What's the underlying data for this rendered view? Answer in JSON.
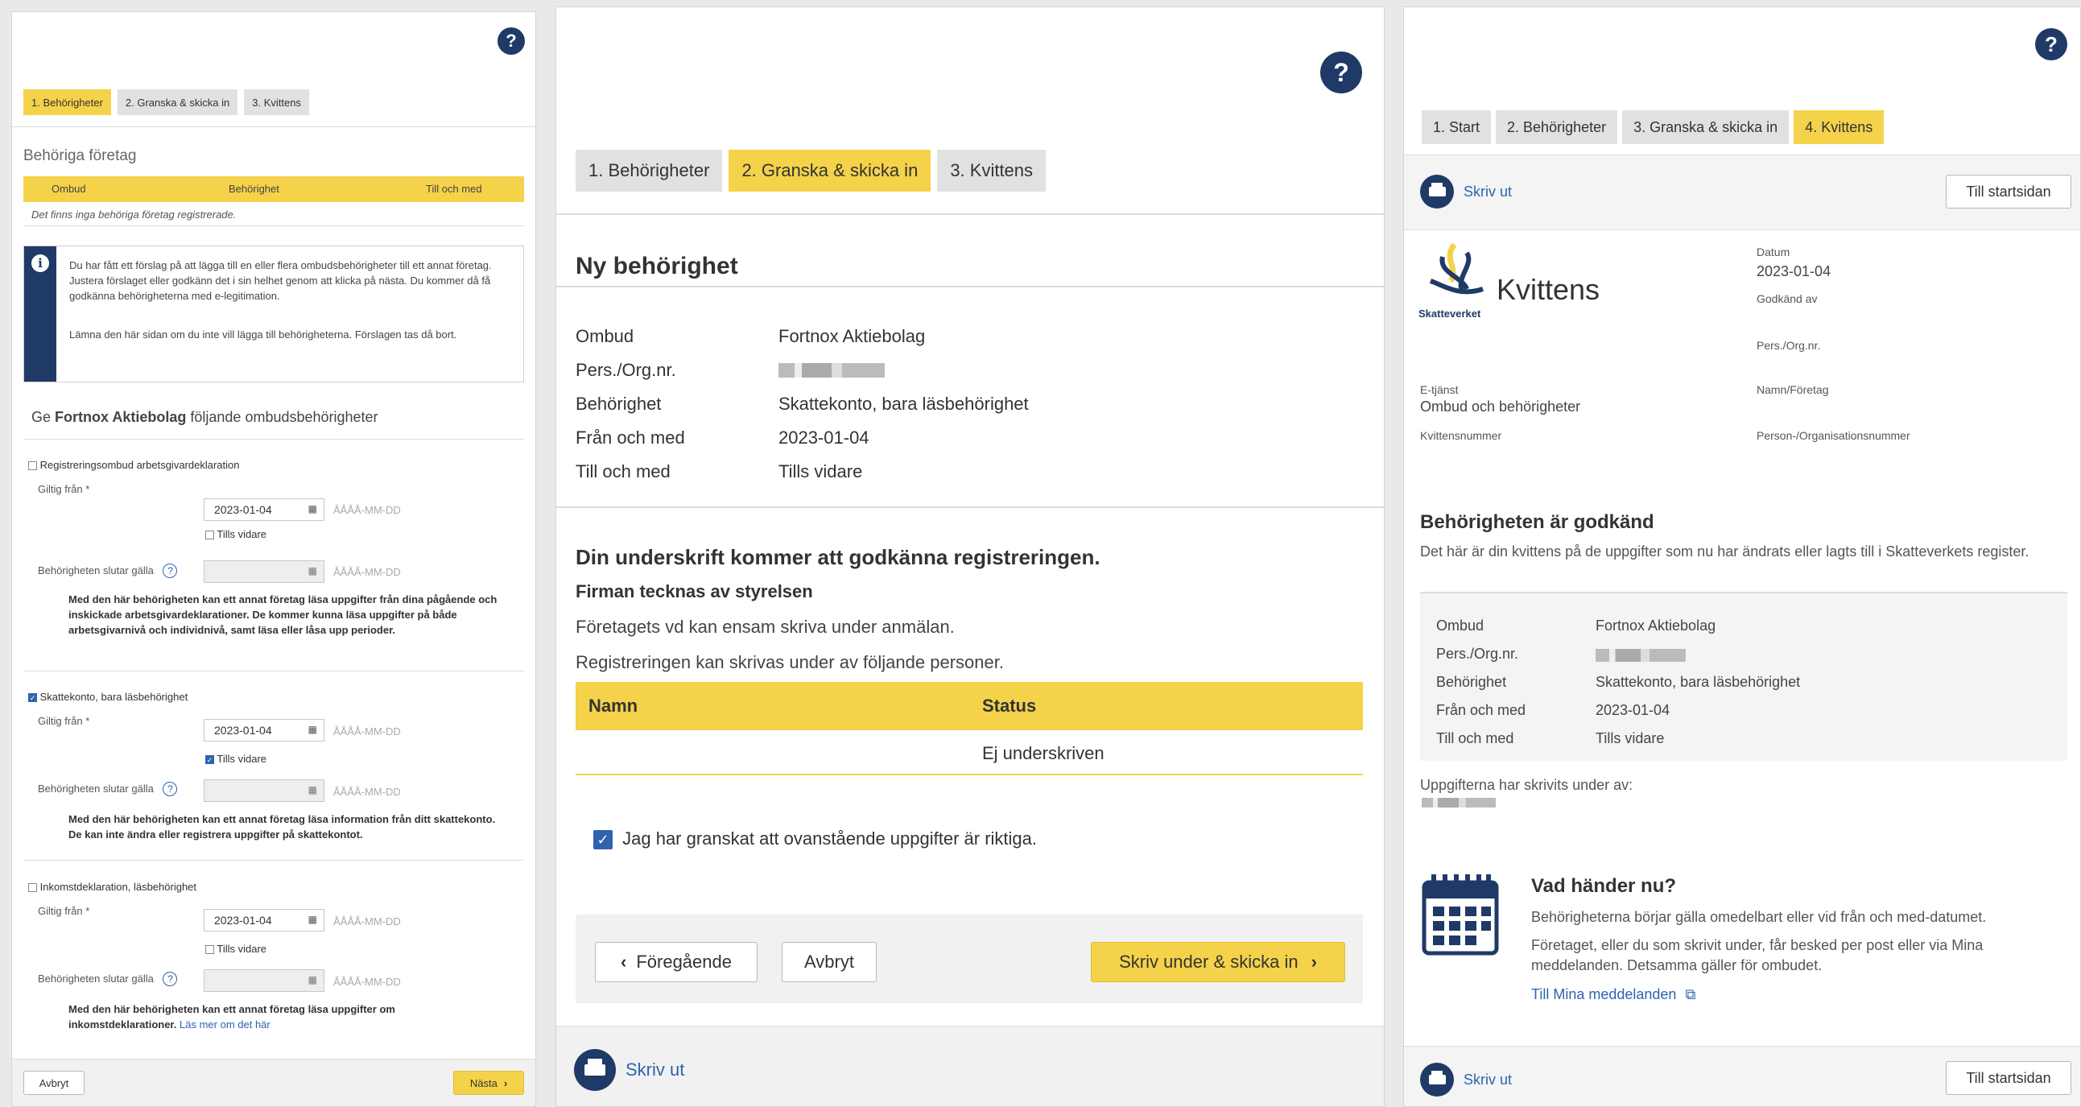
{
  "p1": {
    "help": "?",
    "steps": [
      "1. Behörigheter",
      "2. Granska & skicka in",
      "3. Kvittens"
    ],
    "section_title": "Behöriga företag",
    "table_headers": [
      "Ombud",
      "Behörighet",
      "Till och med"
    ],
    "table_empty": "Det finns inga behöriga företag registrerade.",
    "info_icon": "info-icon",
    "info_text1": "Du har fått ett förslag på att lägga till en eller flera ombudsbehörigheter till ett annat företag. Justera förslaget eller godkänn det i sin helhet genom att klicka på nästa. Du kommer då få godkänna behörigheterna med e-legitimation.",
    "info_text2": "Lämna den här sidan om du inte vill lägga till behörigheterna. Förslagen tas då bort.",
    "ge_prefix": "Ge",
    "ge_company": "Fortnox Aktiebolag",
    "ge_suffix": "följande ombudsbehörigheter",
    "date_placeholder": "ÅÅÅÅ-MM-DD",
    "label_from": "Giltig från *",
    "label_until_vidare": "Tills vidare",
    "label_ends": "Behörigheten slutar gälla",
    "groups": [
      {
        "title": "Registreringsombud arbetsgivardeklaration",
        "checked": false,
        "date": "2023-01-04",
        "tills_checked": false,
        "desc": "Med den här behörigheten kan ett annat företag läsa uppgifter från dina pågående och inskickade arbetsgivardeklarationer. De kommer kunna läsa uppgifter på både arbetsgivarnivå och individnivå, samt läsa eller låsa upp perioder."
      },
      {
        "title": "Skattekonto, bara läsbehörighet",
        "checked": true,
        "date": "2023-01-04",
        "tills_checked": true,
        "desc": "Med den här behörigheten kan ett annat företag läsa information från ditt skattekonto. De kan inte ändra eller registrera uppgifter på skattekontot."
      },
      {
        "title": "Inkomstdeklaration, läsbehörighet",
        "checked": false,
        "date": "2023-01-04",
        "tills_checked": false,
        "desc": "Med den här behörigheten kan ett annat företag läsa uppgifter om inkomstdeklarationer.",
        "link": "Läs mer om det här"
      }
    ],
    "cancel": "Avbryt",
    "next": "Nästa"
  },
  "p2": {
    "help": "?",
    "steps": [
      "1. Behörigheter",
      "2. Granska & skicka in",
      "3. Kvittens"
    ],
    "title": "Ny behörighet",
    "details": [
      {
        "label": "Ombud",
        "value": "Fortnox Aktiebolag"
      },
      {
        "label": "Pers./Org.nr.",
        "value": ""
      },
      {
        "label": "Behörighet",
        "value": "Skattekonto, bara läsbehörighet"
      },
      {
        "label": "Från och med",
        "value": "2023-01-04"
      },
      {
        "label": "Till och med",
        "value": "Tills vidare"
      }
    ],
    "sign_heading": "Din underskrift kommer att godkänna registreringen.",
    "firm_heading": "Firman tecknas av styrelsen",
    "firm_text1": "Företagets vd kan ensam skriva under anmälan.",
    "firm_text2": "Registreringen kan skrivas under av följande personer.",
    "sign_table_headers": [
      "Namn",
      "Status"
    ],
    "sign_table_rows": [
      {
        "name": "",
        "status": "Ej underskriven"
      }
    ],
    "confirm_label": "Jag har granskat att ovanstående uppgifter är riktiga.",
    "confirm_checked": true,
    "prev": "Föregående",
    "cancel": "Avbryt",
    "submit": "Skriv under & skicka in",
    "print": "Skriv ut"
  },
  "p3": {
    "help": "?",
    "steps": [
      "1. Start",
      "2. Behörigheter",
      "3. Granska & skicka in",
      "4. Kvittens"
    ],
    "print": "Skriv ut",
    "home": "Till startsidan",
    "logo_text": "Skatteverket",
    "receipt_title": "Kvittens",
    "datum_label": "Datum",
    "datum_value": "2023-01-04",
    "godkand_label": "Godkänd av",
    "pers_label": "Pers./Org.nr.",
    "etjanst_label": "E-tjänst",
    "etjanst_value": "Ombud och behörigheter",
    "namn_label": "Namn/Företag",
    "kvittens_label": "Kvittensnummer",
    "person_org_label": "Person-/Organisationsnummer",
    "approved_heading": "Behörigheten är godkänd",
    "approved_text": "Det här är din kvittens på de uppgifter som nu har ändrats eller lagts till i Skatteverkets register.",
    "details": [
      {
        "label": "Ombud",
        "value": "Fortnox Aktiebolag"
      },
      {
        "label": "Pers./Org.nr.",
        "value": ""
      },
      {
        "label": "Behörighet",
        "value": "Skattekonto, bara läsbehörighet"
      },
      {
        "label": "Från och med",
        "value": "2023-01-04"
      },
      {
        "label": "Till och med",
        "value": "Tills vidare"
      }
    ],
    "signed_by": "Uppgifterna har skrivits under av:",
    "next_heading": "Vad händer nu?",
    "next_text1": "Behörigheterna börjar gälla omedelbart eller vid från och med-datumet.",
    "next_text2": "Företaget, eller du som skrivit under, får besked per post eller via Mina meddelanden. Detsamma gäller för ombudet.",
    "next_link": "Till Mina meddelanden"
  },
  "colors": {
    "accent": "#f4d24a",
    "navy": "#1f3a66",
    "link": "#2f63b0"
  }
}
